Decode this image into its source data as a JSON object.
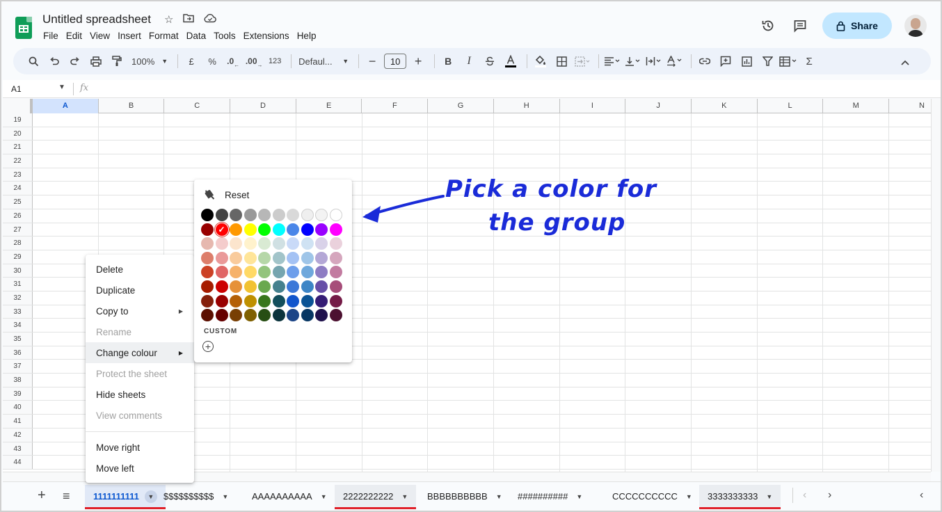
{
  "app": {
    "title": "Untitled spreadsheet",
    "menu": [
      "File",
      "Edit",
      "View",
      "Insert",
      "Format",
      "Data",
      "Tools",
      "Extensions",
      "Help"
    ],
    "share_label": "Share"
  },
  "toolbar": {
    "zoom": "100%",
    "currency": "£",
    "percent": "%",
    "dec_decrease": ".0",
    "dec_increase": ".00",
    "number_format": "123",
    "font": "Defaul...",
    "font_size": "10",
    "bold": "B",
    "italic": "I",
    "function": "Σ"
  },
  "formula_bar": {
    "cell_ref": "A1",
    "fx": "fx"
  },
  "grid": {
    "columns": [
      "A",
      "B",
      "C",
      "D",
      "E",
      "F",
      "G",
      "H",
      "I",
      "J",
      "K",
      "L",
      "M",
      "N"
    ],
    "selected_column": "A",
    "rows": [
      "19",
      "20",
      "21",
      "22",
      "23",
      "24",
      "25",
      "26",
      "27",
      "28",
      "29",
      "30",
      "31",
      "32",
      "33",
      "34",
      "35",
      "36",
      "37",
      "38",
      "39",
      "40",
      "41",
      "42",
      "43",
      "44"
    ]
  },
  "context_menu": {
    "items": [
      {
        "label": "Delete",
        "disabled": false
      },
      {
        "label": "Duplicate",
        "disabled": false
      },
      {
        "label": "Copy to",
        "disabled": false,
        "submenu": true
      },
      {
        "label": "Rename",
        "disabled": true
      },
      {
        "label": "Change colour",
        "disabled": false,
        "submenu": true,
        "highlighted": true
      },
      {
        "label": "Protect the sheet",
        "disabled": true
      },
      {
        "label": "Hide sheets",
        "disabled": false
      },
      {
        "label": "View comments",
        "disabled": true
      },
      {
        "label": "Move right",
        "disabled": false
      },
      {
        "label": "Move left",
        "disabled": false
      }
    ]
  },
  "color_picker": {
    "reset_label": "Reset",
    "custom_label": "CUSTOM",
    "selected": "#ff0000",
    "swatches": [
      [
        "#000000",
        "#434343",
        "#666666",
        "#999999",
        "#b7b7b7",
        "#cccccc",
        "#d9d9d9",
        "#efefef",
        "#f3f3f3",
        "#ffffff"
      ],
      [
        "#980000",
        "#ff0000",
        "#ff9900",
        "#ffff00",
        "#00ff00",
        "#00ffff",
        "#4a86e8",
        "#0000ff",
        "#9900ff",
        "#ff00ff"
      ],
      [
        "#e6b8af",
        "#f4cccc",
        "#fce5cd",
        "#fff2cc",
        "#d9ead3",
        "#d0e0e3",
        "#c9daf8",
        "#cfe2f3",
        "#d9d2e9",
        "#ead1dc"
      ],
      [
        "#dd7e6b",
        "#ea9999",
        "#f9cb9c",
        "#ffe599",
        "#b6d7a8",
        "#a2c4c9",
        "#a4c2f4",
        "#9fc5e8",
        "#b4a7d6",
        "#d5a6bd"
      ],
      [
        "#cc4125",
        "#e06666",
        "#f6b26b",
        "#ffd966",
        "#93c47d",
        "#76a5af",
        "#6d9eeb",
        "#6fa8dc",
        "#8e7cc3",
        "#c27ba0"
      ],
      [
        "#a61c00",
        "#cc0000",
        "#e69138",
        "#f1c232",
        "#6aa84f",
        "#45818e",
        "#3c78d8",
        "#3d85c6",
        "#674ea7",
        "#a64d79"
      ],
      [
        "#85200c",
        "#990000",
        "#b45f06",
        "#bf9000",
        "#38761d",
        "#134f5c",
        "#1155cc",
        "#0b5394",
        "#351c75",
        "#741b47"
      ],
      [
        "#5b0f00",
        "#660000",
        "#783f04",
        "#7f6000",
        "#274e13",
        "#0c343d",
        "#1c4587",
        "#073763",
        "#20124d",
        "#4c1130"
      ]
    ]
  },
  "sheet_tabs": [
    {
      "label": "1111111111",
      "active": true,
      "grouped": true
    },
    {
      "label": "$$$$$$$$$$",
      "active": false,
      "grouped": false
    },
    {
      "label": "AAAAAAAAAA",
      "active": false,
      "grouped": false
    },
    {
      "label": "2222222222",
      "active": false,
      "grouped": true
    },
    {
      "label": "BBBBBBBBBB",
      "active": false,
      "grouped": false
    },
    {
      "label": "##########",
      "active": false,
      "grouped": false
    },
    {
      "label": "CCCCCCCCCC",
      "active": false,
      "grouped": false
    },
    {
      "label": "3333333333",
      "active": false,
      "grouped": true
    }
  ],
  "annotation": {
    "line1": "Pick a color for",
    "line2": "the group",
    "color": "#1a2bd8"
  }
}
